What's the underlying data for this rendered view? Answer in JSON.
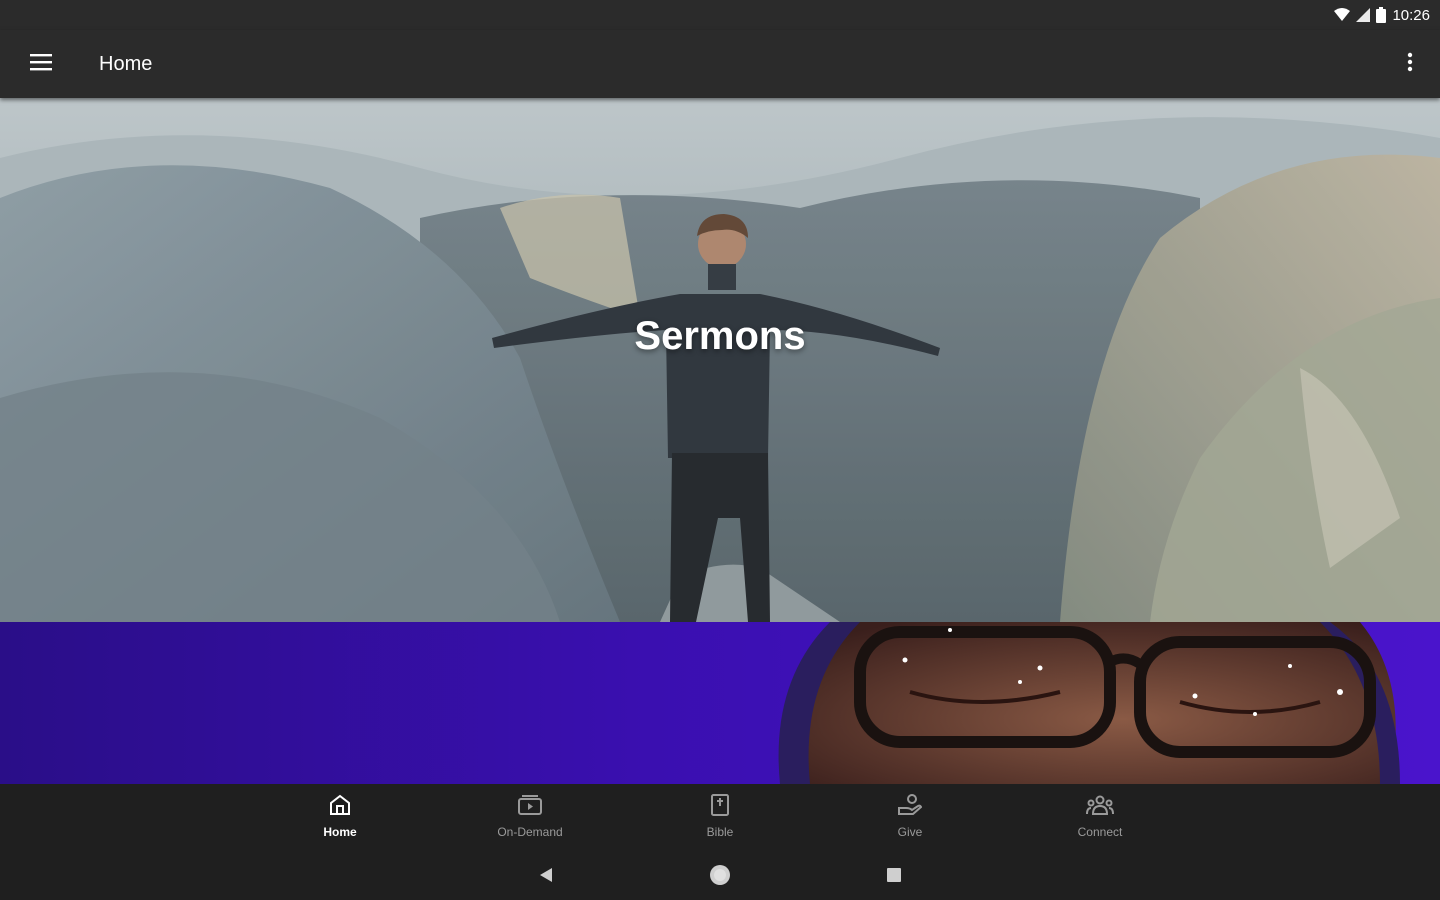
{
  "status_bar": {
    "time": "10:26"
  },
  "app_bar": {
    "title": "Home"
  },
  "hero": {
    "label": "Sermons"
  },
  "bottom_nav": {
    "items": [
      {
        "label": "Home",
        "icon": "home-icon",
        "active": true
      },
      {
        "label": "On-Demand",
        "icon": "on-demand-icon",
        "active": false
      },
      {
        "label": "Bible",
        "icon": "bible-icon",
        "active": false
      },
      {
        "label": "Give",
        "icon": "give-icon",
        "active": false
      },
      {
        "label": "Connect",
        "icon": "connect-icon",
        "active": false
      }
    ]
  },
  "colors": {
    "app_bar": "#2b2b2b",
    "banner_purple": "#3a0fb0",
    "nav_background": "#1f1f1f"
  }
}
